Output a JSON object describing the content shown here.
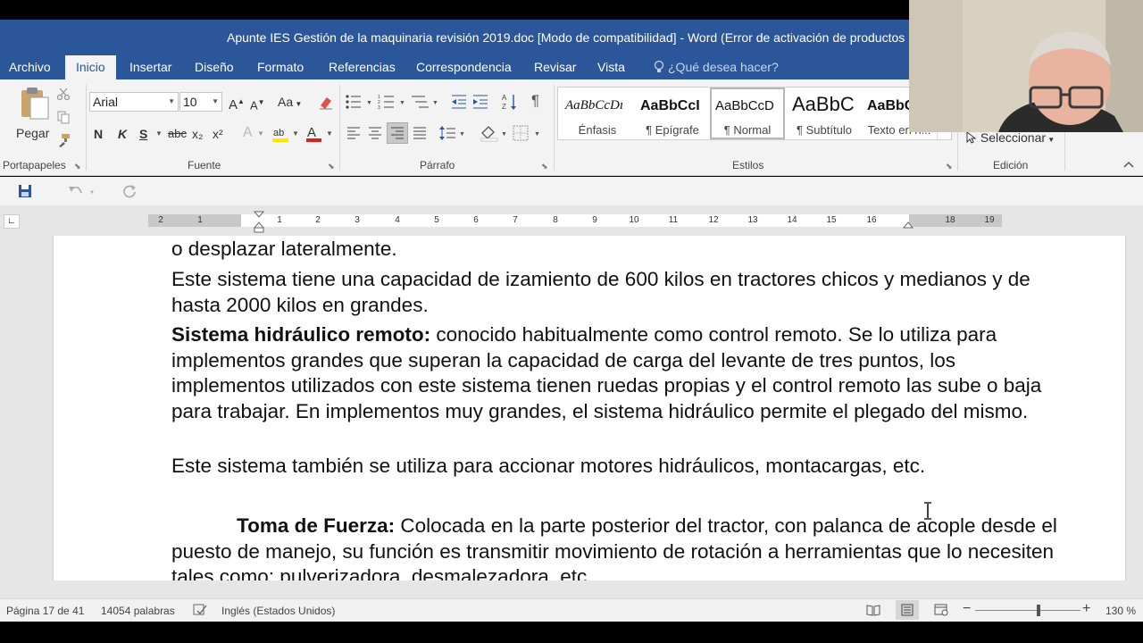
{
  "window": {
    "title": "Apunte IES Gestión de la maquinaria revisión 2019.doc [Modo de compatibilidad] - Word (Error de activación de productos"
  },
  "tabs": [
    {
      "label": "Archivo"
    },
    {
      "label": "Inicio"
    },
    {
      "label": "Insertar"
    },
    {
      "label": "Diseño"
    },
    {
      "label": "Formato"
    },
    {
      "label": "Referencias"
    },
    {
      "label": "Correspondencia"
    },
    {
      "label": "Revisar"
    },
    {
      "label": "Vista"
    }
  ],
  "tell_me": "¿Qué desea hacer?",
  "ribbon": {
    "clipboard": {
      "paste_label": "Pegar",
      "group_label": "Portapapeles"
    },
    "font": {
      "font_name": "Arial",
      "font_size": "10",
      "bold": "N",
      "italic": "K",
      "underline": "S",
      "strike": "abc",
      "subscript": "x₂",
      "superscript": "x²",
      "grow": "A",
      "shrink": "A",
      "change_case": "Aa",
      "group_label": "Fuente"
    },
    "paragraph": {
      "group_label": "Párrafo"
    },
    "styles": {
      "items": [
        {
          "preview": "AaBbCcDı",
          "name": "Énfasis"
        },
        {
          "preview": "AaBbCcI",
          "name": "¶ Epígrafe"
        },
        {
          "preview": "AaBbCcD",
          "name": "¶ Normal"
        },
        {
          "preview": "AaBbC",
          "name": "¶ Subtítulo"
        },
        {
          "preview": "AaBbC",
          "name": "Texto en n..."
        }
      ],
      "group_label": "Estilos"
    },
    "editing": {
      "select_label": "Seleccionar",
      "group_label": "Edición"
    }
  },
  "ruler": {
    "ticks": [
      "2",
      "1",
      "1",
      "2",
      "3",
      "4",
      "5",
      "6",
      "7",
      "8",
      "9",
      "10",
      "11",
      "12",
      "13",
      "14",
      "15",
      "16",
      "18",
      "19"
    ]
  },
  "document": {
    "line0": "o desplazar lateralmente.",
    "p1": "Este sistema tiene una capacidad de izamiento de 600 kilos en tractores chicos y medianos y de hasta 2000 kilos en grandes.",
    "p2_bold": "Sistema hidráulico remoto:",
    "p2_text": " conocido habitualmente como control remoto. Se lo utiliza para implementos grandes que superan la capacidad de carga del levante de tres puntos, los implementos utilizados con este sistema tienen ruedas propias y el control remoto las sube o baja para trabajar. En implementos muy grandes, el sistema hidráulico permite el plegado del mismo.",
    "p3": "Este sistema también se utiliza para accionar motores hidráulicos, montacargas, etc.",
    "p4_bold": "Toma de Fuerza:",
    "p4_text": " Colocada en la parte posterior del tractor, con palanca de acople desde el puesto de manejo, su función es transmitir movimiento de rotación a herramientas que lo necesiten tales como: pulverizadora, desmalezadora, etc."
  },
  "status": {
    "page": "Página 17 de 41",
    "words": "14054 palabras",
    "language": "Inglés (Estados Unidos)",
    "zoom": "130 %",
    "zoom_level": 0.6
  },
  "colors": {
    "accent": "#2b579a",
    "ribbon_bg": "#f3f3f3",
    "font_color_red": "#e02020",
    "highlight_yellow": "#ffe600"
  }
}
